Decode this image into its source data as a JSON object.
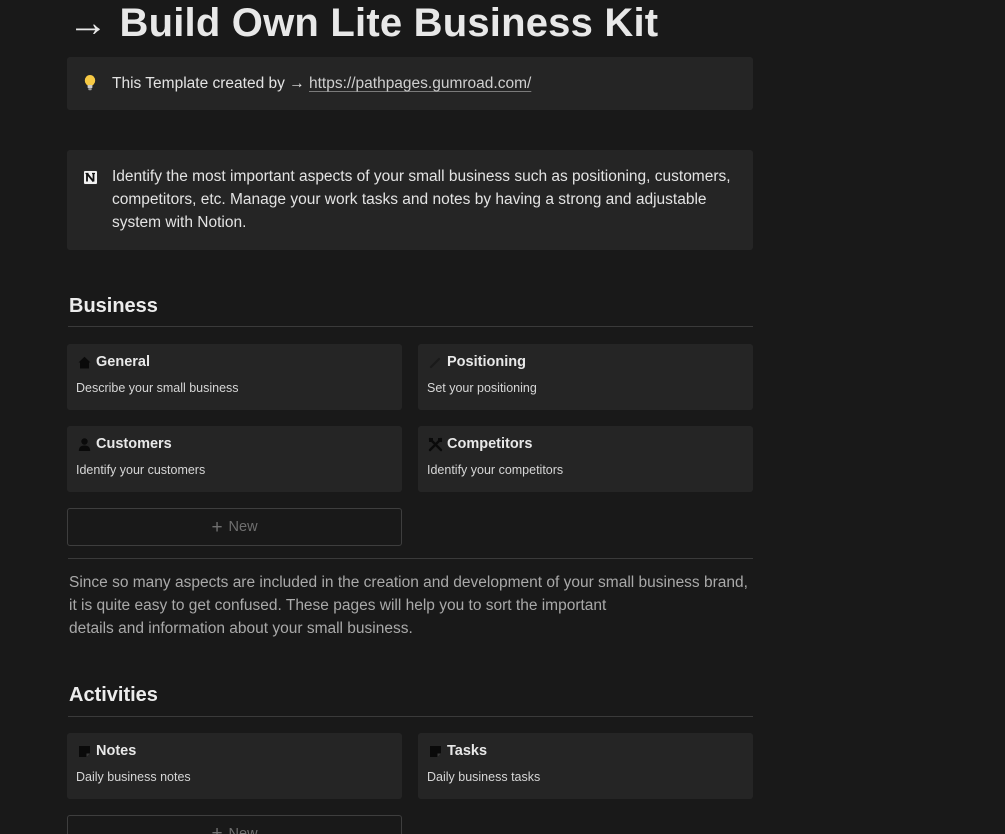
{
  "page": {
    "title": "→ Build Own Lite Business Kit"
  },
  "callouts": [
    {
      "icon": "lightbulb-icon",
      "text_prefix": "This Template created by → ",
      "link": "https://pathpages.gumroad.com/"
    },
    {
      "icon": "notion-logo-icon",
      "text": "Identify the most important aspects of your small business such as positioning, customers, competitors, etc. Manage your work tasks and notes by having a strong and adjustable system with Notion."
    }
  ],
  "business": {
    "heading": "Business",
    "cards": [
      {
        "icon": "house-icon",
        "title": "General",
        "description": "Describe your small business"
      },
      {
        "icon": "pencil-icon",
        "title": "Positioning",
        "description": "Set your positioning"
      },
      {
        "icon": "person-icon",
        "title": "Customers",
        "description": "Identify your customers"
      },
      {
        "icon": "crossed-swords-icon",
        "title": "Competitors",
        "description": "Identify your competitors"
      }
    ],
    "new_label": "New",
    "paragraph": [
      "Since so many aspects are included in the creation and development of your small business brand,",
      "it is quite easy to get confused. These pages will help you to sort the important",
      "details and information about your small business."
    ]
  },
  "activities": {
    "heading": "Activities",
    "cards": [
      {
        "icon": "note-icon",
        "title": "Notes",
        "description": "Daily business notes"
      },
      {
        "icon": "note-icon",
        "title": "Tasks",
        "description": "Daily business tasks"
      }
    ],
    "new_label": "New"
  },
  "colors": {
    "background": "#191919",
    "card": "#252525",
    "text": "#e6e6e6",
    "muted_text": "#a9a9a9"
  }
}
